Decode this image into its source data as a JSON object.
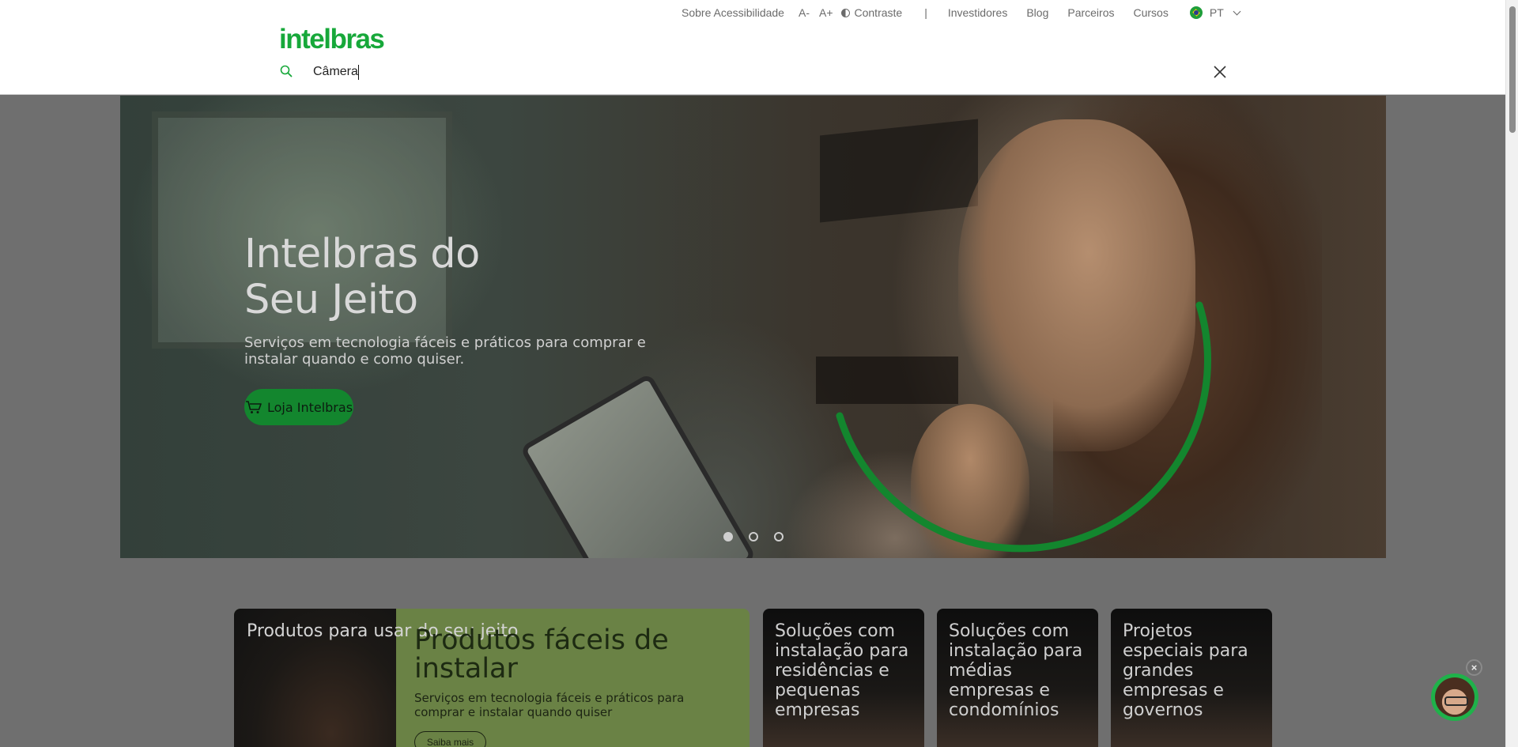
{
  "topbar": {
    "accessibility": "Sobre Acessibilidade",
    "font_decrease": "A-",
    "font_increase": "A+",
    "contrast": "Contraste",
    "separator": "|",
    "investors": "Investidores",
    "blog": "Blog",
    "partners": "Parceiros",
    "courses": "Cursos",
    "language": "PT"
  },
  "logo": "intelbras",
  "search": {
    "value": "Câmera"
  },
  "hero": {
    "title_line1": "Intelbras do",
    "title_line2": "Seu Jeito",
    "subtitle": "Serviços em tecnologia fáceis e práticos para comprar e instalar quando e como quiser.",
    "cta_label": "Loja Intelbras",
    "slide_count": 3,
    "active_slide": 1,
    "accent_color": "#13862e"
  },
  "cards": {
    "products": {
      "left_title": "Produtos para usar do seu jeito",
      "title": "Produtos fáceis de instalar",
      "subtitle": "Serviços em tecnologia fáceis e práticos para comprar e instalar quando quiser",
      "cta": "Saiba mais"
    },
    "residences": "Soluções com instalação para residências e pequenas empresas",
    "medium": "Soluções com instalação para médias empresas e condomínios",
    "large": "Projetos especiais para grandes empresas e governos"
  },
  "chat": {
    "close": "×"
  },
  "colors": {
    "brand": "#17a83a",
    "overlay": "#6f6f6f"
  }
}
